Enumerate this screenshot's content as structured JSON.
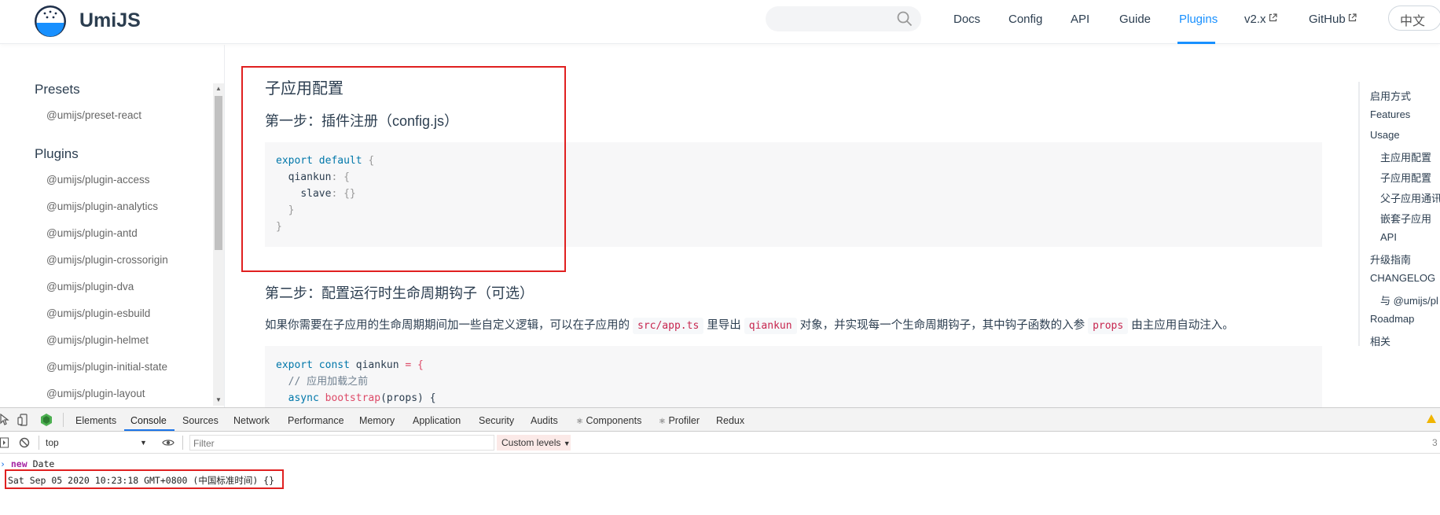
{
  "header": {
    "brand": "UmiJS",
    "search_placeholder": "",
    "nav": [
      {
        "label": "Docs"
      },
      {
        "label": "Config"
      },
      {
        "label": "API"
      },
      {
        "label": "Guide"
      },
      {
        "label": "Plugins",
        "active": true
      },
      {
        "label": "v2.x",
        "external": true
      },
      {
        "label": "GitHub",
        "external": true
      }
    ],
    "lang_button": "中文",
    "accent": "#1890ff"
  },
  "sidebar": {
    "groups": [
      {
        "title": "Presets",
        "items": [
          "@umijs/preset-react"
        ]
      },
      {
        "title": "Plugins",
        "items": [
          "@umijs/plugin-access",
          "@umijs/plugin-analytics",
          "@umijs/plugin-antd",
          "@umijs/plugin-crossorigin",
          "@umijs/plugin-dva",
          "@umijs/plugin-esbuild",
          "@umijs/plugin-helmet",
          "@umijs/plugin-initial-state",
          "@umijs/plugin-layout"
        ]
      }
    ]
  },
  "content": {
    "heading_sub_app": "子应用配置",
    "step1_prefix": "第一步：插件注册（",
    "step1_file": "config.js",
    "step1_suffix": "）",
    "code1": {
      "l1_kw1": "export",
      "l1_kw2": "default",
      "l1_brace": "{",
      "l2_key": "qiankun",
      "l2_punc": ": {",
      "l3_key": "slave",
      "l3_punc": ": {}",
      "l4": "}",
      "l5": "}"
    },
    "step2_heading": "第二步：配置运行时生命周期钩子（可选）",
    "para": {
      "t1": "如果你需要在子应用的生命周期期间加一些自定义逻辑，可以在子应用的",
      "c1": "src/app.ts",
      "t2": "里导出",
      "c2": "qiankun",
      "t3": "对象，并实现每一个生命周期钩子，其中钩子函数的入参",
      "c3": "props",
      "t4": "由主应用自动注入。"
    },
    "code2": {
      "l1_kw1": "export",
      "l1_kw2": "const",
      "l1_name": "qiankun",
      "l1_punc": "= {",
      "l2_comment": "// 应用加载之前",
      "l3_kw": "async",
      "l3_fn": "bootstrap",
      "l3_args": "(props) {"
    }
  },
  "toc": {
    "items": [
      {
        "label": "启用方式",
        "indent": 0
      },
      {
        "label": "Features",
        "indent": 0
      },
      {
        "label": "Usage",
        "indent": 0
      },
      {
        "label": "主应用配置",
        "indent": 1
      },
      {
        "label": "子应用配置",
        "indent": 1
      },
      {
        "label": "父子应用通讯",
        "indent": 1
      },
      {
        "label": "嵌套子应用",
        "indent": 1
      },
      {
        "label": "API",
        "indent": 1
      },
      {
        "label": "升级指南",
        "indent": 0
      },
      {
        "label": "CHANGELOG",
        "indent": 0
      },
      {
        "label": "与 @umijs/pl",
        "indent": 1
      },
      {
        "label": "Roadmap",
        "indent": 0
      },
      {
        "label": "相关",
        "indent": 0
      }
    ]
  },
  "devtools": {
    "tabs": [
      "Elements",
      "Console",
      "Sources",
      "Network",
      "Performance",
      "Memory",
      "Application",
      "Security",
      "Audits",
      "Components",
      "Profiler",
      "Redux"
    ],
    "active_tab": "Console",
    "context": "top",
    "filter_placeholder": "Filter",
    "levels": "Custom levels",
    "right_count": "3",
    "console": {
      "input_kw": "new",
      "input_rest": "Date",
      "output": "Sat Sep 05 2020 10:23:18 GMT+0800 (中国标准时间) {}"
    }
  }
}
